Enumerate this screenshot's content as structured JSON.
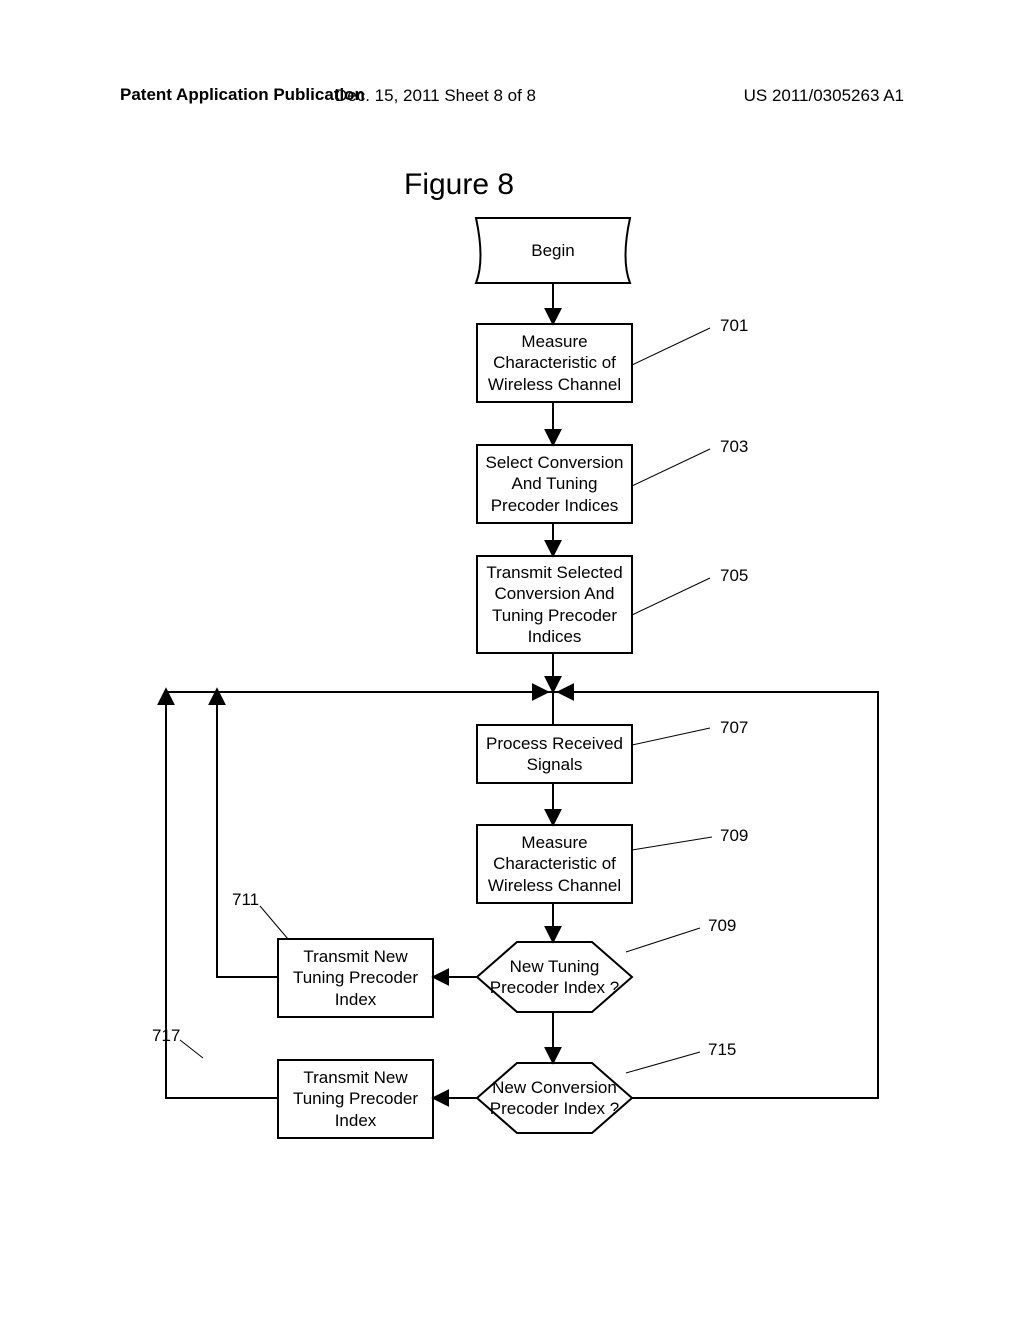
{
  "header": {
    "left": "Patent Application Publication",
    "center": "Dec. 15, 2011   Sheet 8 of 8",
    "right": "US 2011/0305263 A1"
  },
  "figure_title": "Figure 8",
  "nodes": {
    "begin": "Begin",
    "b701": "Measure Characteristic of Wireless Channel",
    "b703": "Select Conversion And Tuning Precoder Indices",
    "b705": "Transmit Selected Conversion And Tuning Precoder Indices",
    "b707": "Process Received Signals",
    "b709": "Measure Characteristic of Wireless Channel",
    "d709": "New Tuning Precoder Index ?",
    "d715": "New Conversion Precoder Index ?",
    "b711": "Transmit New Tuning Precoder Index",
    "b717": "Transmit New Tuning Precoder Index"
  },
  "labels": {
    "l701": "701",
    "l703": "703",
    "l705": "705",
    "l707": "707",
    "l709a": "709",
    "l709b": "709",
    "l711": "711",
    "l715": "715",
    "l717": "717"
  }
}
